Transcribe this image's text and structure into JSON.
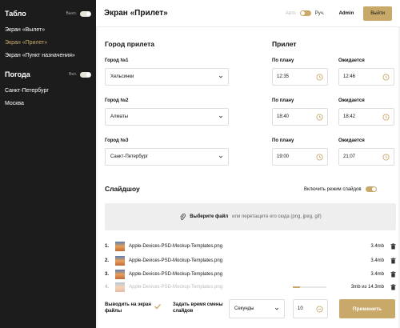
{
  "sidebar": {
    "tablo_title": "Табло",
    "tablo_toggle_label": "Выкл.",
    "tablo_items": [
      "Экран «Вылет»",
      "Экран «Прилет»",
      "Экран «Пункт назначения»"
    ],
    "weather_title": "Погода",
    "weather_toggle_label": "Вкл.",
    "weather_items": [
      "Санкт-Петербург",
      "Москва"
    ]
  },
  "header": {
    "title": "Экран «Прилет»",
    "mode_auto": "Авто",
    "mode_manual": "Руч.",
    "user": "Admin",
    "logout": "Выйти"
  },
  "arrival": {
    "city_title": "Город прилета",
    "arrival_title": "Прилет",
    "planned_label": "По плану",
    "expected_label": "Ожидается",
    "rows": [
      {
        "label": "Город №1",
        "city": "Хельсинки",
        "planned": "12:35",
        "expected": "12:46"
      },
      {
        "label": "Город №2",
        "city": "Алматы",
        "planned": "18:40",
        "expected": "18:42"
      },
      {
        "label": "Город №3",
        "city": "Санкт-Петербург",
        "planned": "19:00",
        "expected": "21:07"
      }
    ]
  },
  "slideshow": {
    "title": "Слайдшоу",
    "enable_label": "Включить режим слайдов",
    "drop_bold": "Выберите файл",
    "drop_rest": "или перетащите его сюда (png, jpeg, gif)",
    "files": [
      {
        "num": "1.",
        "name": "Apple-Devices-PSD-Mockup-Templates.png",
        "size": "3.4mb"
      },
      {
        "num": "2.",
        "name": "Apple-Devices-PSD-Mockup-Templates.png",
        "size": "3.4mb"
      },
      {
        "num": "3.",
        "name": "Apple-Devices-PSD-Mockup-Templates.png",
        "size": "3.4mb"
      },
      {
        "num": "4.",
        "name": "Apple-Devices-PSD-Mockup-Templates.png",
        "size": "3mb из 14.3mb",
        "progress": 0.21
      }
    ],
    "show_files_label": "Выводить на экран файлы",
    "set_time_label": "Задать время смены слайдов",
    "unit_select": "Секунды",
    "interval_value": "10",
    "apply": "Применить"
  },
  "colors": {
    "accent": "#c8a96a",
    "sidebar_bg": "#1c1c1c"
  }
}
